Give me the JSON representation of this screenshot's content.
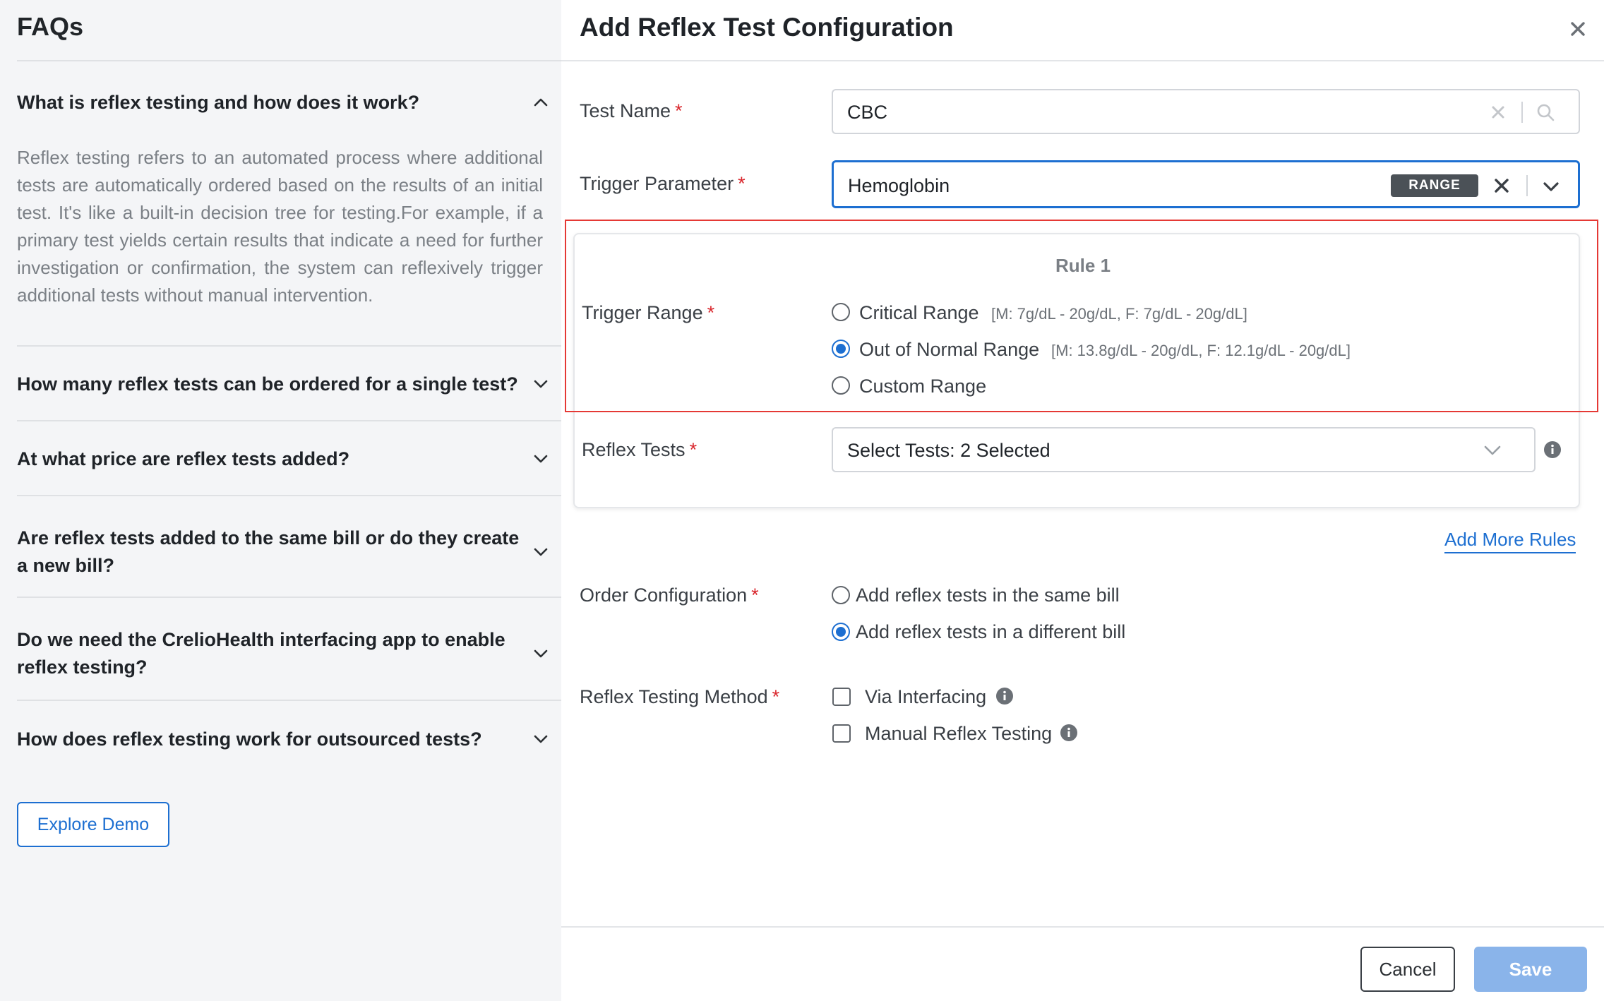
{
  "faq": {
    "title": "FAQs",
    "items": [
      {
        "question": "What is reflex testing and how does it work?",
        "expanded": true,
        "answer": "Reflex testing refers to an automated process where additional tests are automatically ordered based on the results of an initial test. It's like a built-in decision tree for testing.For example, if a primary test yields certain results that indicate a need for further investigation or confirmation, the system can reflexively trigger additional tests without manual intervention."
      },
      {
        "question": "How many reflex tests can be ordered for a single test?",
        "expanded": false
      },
      {
        "question": "At what price are reflex tests added?",
        "expanded": false
      },
      {
        "question": "Are reflex tests added to the same bill or do they create a new bill?",
        "expanded": false
      },
      {
        "question": "Do we need the CrelioHealth interfacing app to enable reflex testing?",
        "expanded": false
      },
      {
        "question": "How does reflex testing work for outsourced tests?",
        "expanded": false
      }
    ],
    "explore_label": "Explore Demo"
  },
  "modal": {
    "title": "Add Reflex Test Configuration",
    "close_icon": "close-icon",
    "required_mark": "*",
    "test_name": {
      "label": "Test Name",
      "value": "CBC"
    },
    "trigger_parameter": {
      "label": "Trigger Parameter",
      "value": "Hemoglobin",
      "badge": "RANGE"
    },
    "rule": {
      "title": "Rule 1",
      "trigger_range": {
        "label": "Trigger Range",
        "options": [
          {
            "label": "Critical Range",
            "range": "[M: 7g/dL - 20g/dL, F: 7g/dL - 20g/dL]",
            "selected": false
          },
          {
            "label": "Out of Normal Range",
            "range": "[M: 13.8g/dL - 20g/dL, F: 12.1g/dL - 20g/dL]",
            "selected": true
          },
          {
            "label": "Custom Range",
            "range": "",
            "selected": false
          }
        ]
      },
      "reflex_tests": {
        "label": "Reflex Tests",
        "value": "Select Tests: 2 Selected"
      }
    },
    "add_more_rules": "Add More Rules",
    "order_configuration": {
      "label": "Order Configuration",
      "options": [
        {
          "label": "Add reflex tests in the same bill",
          "selected": false
        },
        {
          "label": "Add reflex tests in a different bill",
          "selected": true
        }
      ]
    },
    "reflex_method": {
      "label": "Reflex Testing Method",
      "options": [
        {
          "label": "Via Interfacing",
          "checked": false
        },
        {
          "label": "Manual Reflex Testing",
          "checked": false
        }
      ]
    },
    "cancel_label": "Cancel",
    "save_label": "Save",
    "colors": {
      "accent": "#1d6fd1",
      "required": "#d9262c",
      "highlight": "#e53935",
      "save_disabled": "#8ab4ea"
    }
  }
}
